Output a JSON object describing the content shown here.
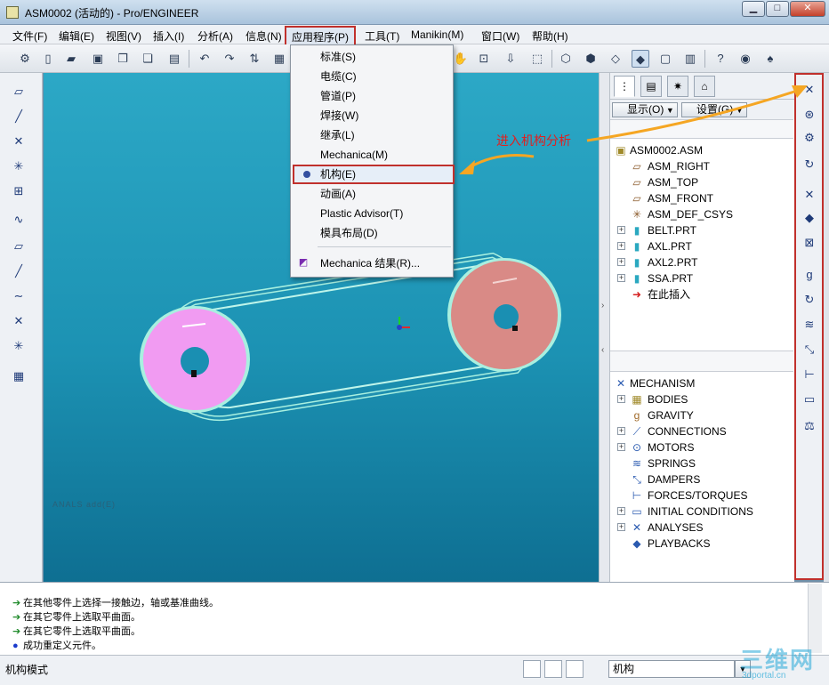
{
  "window": {
    "title": "ASM0002 (活动的) - Pro/ENGINEER",
    "minimize": "▁",
    "maximize": "□",
    "close": "✕"
  },
  "menu": [
    {
      "id": "file",
      "label": "文件(F)"
    },
    {
      "id": "edit",
      "label": "编辑(E)"
    },
    {
      "id": "view",
      "label": "视图(V)"
    },
    {
      "id": "insert",
      "label": "插入(I)"
    },
    {
      "id": "analysis",
      "label": "分析(A)"
    },
    {
      "id": "info",
      "label": "信息(N)"
    },
    {
      "id": "applications",
      "label": "应用程序(P)"
    },
    {
      "id": "tools",
      "label": "工具(T)"
    },
    {
      "id": "manikin",
      "label": "Manikin(M)"
    },
    {
      "id": "window",
      "label": "窗口(W)"
    },
    {
      "id": "help",
      "label": "帮助(H)"
    }
  ],
  "applications_menu": [
    {
      "label": "标准(S)"
    },
    {
      "label": "电缆(C)"
    },
    {
      "label": "管道(P)"
    },
    {
      "label": "焊接(W)"
    },
    {
      "label": "继承(L)"
    },
    {
      "label": "Mechanica(M)"
    },
    {
      "label": "机构(E)"
    },
    {
      "label": "动画(A)"
    },
    {
      "label": "Plastic Advisor(T)"
    },
    {
      "label": "模具布局(D)"
    },
    {
      "label": "Mechanica 结果(R)..."
    }
  ],
  "annotation": {
    "text": "进入机构分析",
    "color": "#e02020",
    "arrow_color": "#f5a623"
  },
  "nav": {
    "show_button": "显示(O)",
    "settings_button": "设置(G)",
    "model_tree": [
      {
        "label": "ASM0002.ASM",
        "icon": "assembly-icon",
        "expandable": false
      },
      {
        "label": "ASM_RIGHT",
        "icon": "datum-plane-icon",
        "expandable": false
      },
      {
        "label": "ASM_TOP",
        "icon": "datum-plane-icon",
        "expandable": false
      },
      {
        "label": "ASM_FRONT",
        "icon": "datum-plane-icon",
        "expandable": false
      },
      {
        "label": "ASM_DEF_CSYS",
        "icon": "csys-icon",
        "expandable": false
      },
      {
        "label": "BELT.PRT",
        "icon": "part-icon",
        "expandable": true
      },
      {
        "label": "AXL.PRT",
        "icon": "part-icon",
        "expandable": true
      },
      {
        "label": "AXL2.PRT",
        "icon": "part-icon",
        "expandable": true
      },
      {
        "label": "SSA.PRT",
        "icon": "part-icon",
        "expandable": true
      },
      {
        "label": "在此插入",
        "icon": "insert-here-icon",
        "expandable": false
      }
    ],
    "mechanism_tree": [
      {
        "label": "MECHANISM",
        "icon": "mechanism-icon",
        "expandable": false
      },
      {
        "label": "BODIES",
        "icon": "bodies-icon",
        "expandable": true
      },
      {
        "label": "GRAVITY",
        "icon": "gravity-icon",
        "expandable": false
      },
      {
        "label": "CONNECTIONS",
        "icon": "connections-icon",
        "expandable": true
      },
      {
        "label": "MOTORS",
        "icon": "motors-icon",
        "expandable": true
      },
      {
        "label": "SPRINGS",
        "icon": "springs-icon",
        "expandable": false
      },
      {
        "label": "DAMPERS",
        "icon": "dampers-icon",
        "expandable": false
      },
      {
        "label": "FORCES/TORQUES",
        "icon": "forces-icon",
        "expandable": false
      },
      {
        "label": "INITIAL CONDITIONS",
        "icon": "initial-conditions-icon",
        "expandable": true
      },
      {
        "label": "ANALYSES",
        "icon": "analyses-icon",
        "expandable": true
      },
      {
        "label": "PLAYBACKS",
        "icon": "playbacks-icon",
        "expandable": false
      }
    ]
  },
  "messages": [
    {
      "icon": "arrow-icon",
      "text": "在其他零件上选择一接触边，轴或基准曲线。"
    },
    {
      "icon": "arrow-icon",
      "text": "在其它零件上选取平曲面。"
    },
    {
      "icon": "arrow-icon",
      "text": "在其它零件上选取平曲面。"
    },
    {
      "icon": "bullet-icon",
      "text": "成功重定义元件。"
    }
  ],
  "status": {
    "mode": "机构模式",
    "filter_value": "机构"
  },
  "viewport": {
    "faint_label": "ANALS add(E)",
    "colors": {
      "left_pulley": "#f19bf2",
      "right_pulley": "#d98a86",
      "belt": "#1f8fb0",
      "belt_edge": "#a8f0e0"
    }
  },
  "watermark": {
    "logo": "三维网",
    "url": "3dportal.cn"
  }
}
